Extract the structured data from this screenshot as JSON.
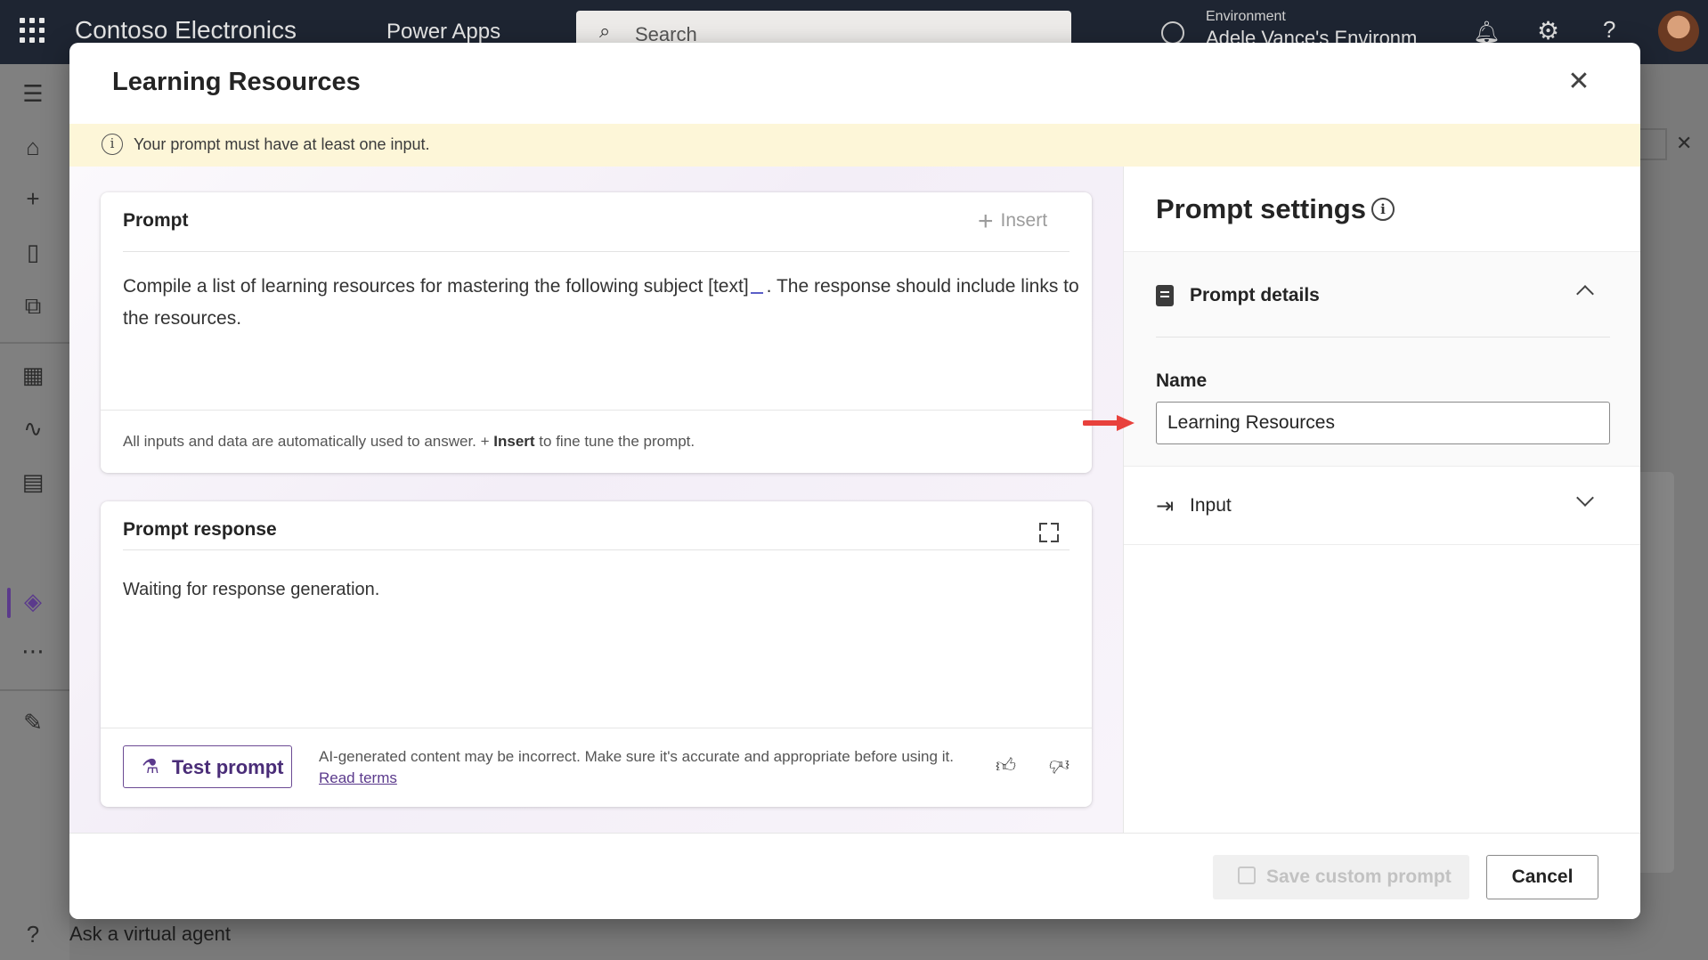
{
  "topbar": {
    "brand": "Contoso Electronics",
    "app_name": "Power Apps",
    "search_placeholder": "Search",
    "environment_label": "Environment",
    "environment_name": "Adele Vance's Environm"
  },
  "background": {
    "bottom_nav_label": "Ask a virtual agent"
  },
  "dialog": {
    "title": "Learning Resources",
    "warning": "Your prompt must have at least one input."
  },
  "prompt_card": {
    "heading": "Prompt",
    "insert_label": "Insert",
    "text_before": "Compile a list of learning resources for mastering the following subject [text]",
    "text_after": ". The response should include links to the resources.",
    "footer_pre": "All inputs and data are automatically used to answer. + ",
    "footer_bold": "Insert",
    "footer_post": " to fine tune the prompt."
  },
  "response_card": {
    "heading": "Prompt response",
    "waiting_text": "Waiting for response generation.",
    "test_button": "Test prompt",
    "disclaimer": "AI-generated content may be incorrect. Make sure it's accurate and appropriate before using it.",
    "read_terms": "Read terms"
  },
  "settings": {
    "title": "Prompt settings",
    "details_label": "Prompt details",
    "name_label": "Name",
    "name_value": "Learning Resources",
    "input_label": "Input"
  },
  "footer": {
    "save_label": "Save custom prompt",
    "cancel_label": "Cancel"
  },
  "colors": {
    "accent": "#5b3a8c",
    "warning_bg": "#fdf6d8",
    "arrow": "#e8413c"
  }
}
